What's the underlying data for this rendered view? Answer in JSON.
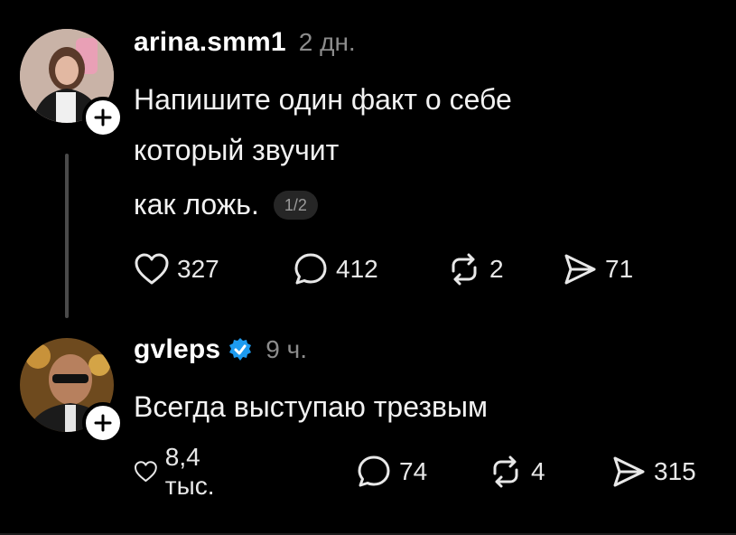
{
  "posts": [
    {
      "username": "arina.smm1",
      "time": "2 дн.",
      "text_lines": [
        "Напишите один факт о себе",
        "который звучит",
        "как ложь."
      ],
      "page_indicator": "1/2",
      "actions": {
        "likes": "327",
        "replies": "412",
        "reposts": "2",
        "shares": "71"
      }
    },
    {
      "username": "gvleps",
      "verified": true,
      "time": "9 ч.",
      "text_lines": [
        "Всегда выступаю трезвым"
      ],
      "actions": {
        "likes": "8,4 тыс.",
        "replies": "74",
        "reposts": "4",
        "shares": "315"
      }
    }
  ],
  "colors": {
    "background": "#000000",
    "text": "#f2f2f2",
    "muted": "#8c8c8c",
    "verified_blue": "#1d9bf0"
  },
  "icons": [
    "heart-icon",
    "comment-icon",
    "repost-icon",
    "share-icon",
    "plus-icon",
    "verified-icon"
  ]
}
